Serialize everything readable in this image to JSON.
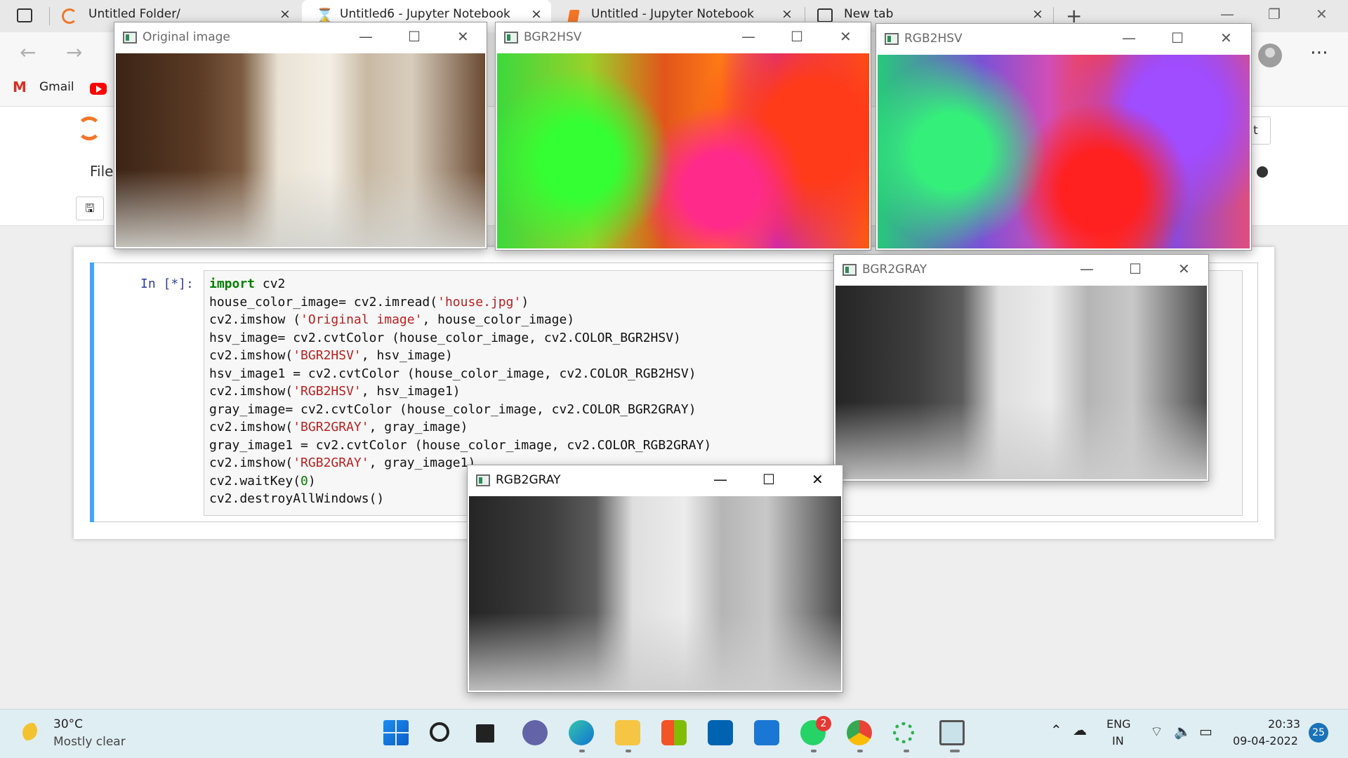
{
  "browser": {
    "tabs": [
      {
        "label": "Untitled Folder/"
      },
      {
        "label": "Untitled6 - Jupyter Notebook"
      },
      {
        "label": "Untitled - Jupyter Notebook"
      },
      {
        "label": "New tab"
      }
    ],
    "close_glyph": "×",
    "new_tab_glyph": "+",
    "bookmarks": {
      "gmail": "Gmail"
    }
  },
  "jupyter": {
    "menu_file": "File",
    "trusted_fragment": "t",
    "cell": {
      "prompt": "In [*]:",
      "code_lines": [
        "import cv2",
        "house_color_image= cv2.imread('house.jpg')",
        "cv2.imshow ('Original image', house_color_image)",
        "hsv_image= cv2.cvtColor (house_color_image, cv2.COLOR_BGR2HSV)",
        "cv2.imshow('BGR2HSV', hsv_image)",
        "hsv_image1 = cv2.cvtColor (house_color_image, cv2.COLOR_RGB2HSV)",
        "cv2.imshow('RGB2HSV', hsv_image1)",
        "gray_image= cv2.cvtColor (house_color_image, cv2.COLOR_BGR2GRAY)",
        "cv2.imshow('BGR2GRAY', gray_image)",
        "gray_image1 = cv2.cvtColor (house_color_image, cv2.COLOR_RGB2GRAY)",
        "cv2.imshow('RGB2GRAY', gray_image1)",
        "cv2.waitKey(0)",
        "cv2.destroyAllWindows()"
      ]
    }
  },
  "windows": [
    {
      "title": "Original image"
    },
    {
      "title": "BGR2HSV"
    },
    {
      "title": "RGB2HSV"
    },
    {
      "title": "BGR2GRAY"
    },
    {
      "title": "RGB2GRAY"
    }
  ],
  "window_buttons": {
    "minimize": "—",
    "maximize": "☐",
    "close": "✕"
  },
  "taskbar": {
    "weather_temp": "30°C",
    "weather_condition": "Mostly clear",
    "whatsapp_badge": "2",
    "language": "ENG",
    "region": "IN",
    "time": "20:33",
    "date": "09-04-2022",
    "notifications": "25"
  },
  "colors": {
    "jupyter_accent": "#f37626",
    "cell_selected": "#42a5f5",
    "taskbar": "#dfeef3"
  }
}
